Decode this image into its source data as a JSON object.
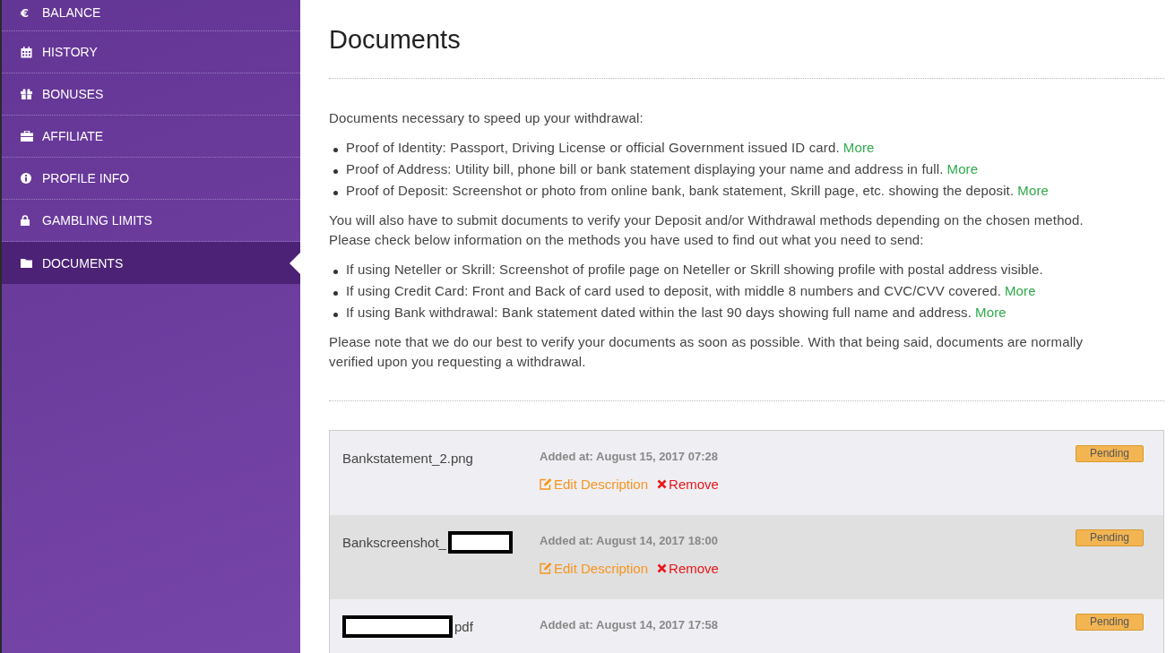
{
  "sidebar": {
    "items": [
      {
        "label": "BALANCE",
        "glyph": "€",
        "selected": false
      },
      {
        "label": "HISTORY",
        "selected": false
      },
      {
        "label": "BONUSES",
        "selected": false
      },
      {
        "label": "AFFILIATE",
        "selected": false
      },
      {
        "label": "PROFILE INFO",
        "selected": false
      },
      {
        "label": "GAMBLING LIMITS",
        "selected": false
      },
      {
        "label": "DOCUMENTS",
        "selected": true
      }
    ]
  },
  "page": {
    "title": "Documents",
    "sections": [
      {
        "kind": "paragraph",
        "text": "Documents necessary to speed up your withdrawal:"
      },
      {
        "kind": "list",
        "items": [
          {
            "text": "Proof of Identity: Passport, Driving License or official Government issued ID card.",
            "link": "More"
          },
          {
            "text": "Proof of Address: Utility bill, phone bill or bank statement displaying your name and address in full.",
            "link": "More"
          },
          {
            "text": "Proof of Deposit: Screenshot or photo from online bank, bank statement, Skrill page, etc. showing the deposit.",
            "link": "More"
          }
        ]
      },
      {
        "kind": "paragraph",
        "text": "You will also have to submit documents to verify your Deposit and/or Withdrawal methods depending on the chosen method. Please check below information on the methods you have used to find out what you need to send:"
      },
      {
        "kind": "list",
        "items": [
          {
            "text": "If using Neteller or Skrill: Screenshot of profile page on Neteller or Skrill showing profile with postal address visible."
          },
          {
            "text": "If using Credit Card: Front and Back of card used to deposit, with middle 8 numbers and CVC/CVV covered.",
            "link": "More"
          },
          {
            "text": "If using Bank withdrawal: Bank statement dated within the last 90 days showing full name and address.",
            "link": "More"
          }
        ]
      },
      {
        "kind": "paragraph",
        "text": "Please note that we do our best to verify your documents as soon as possible. With that being said, documents are normally verified upon you requesting a withdrawal."
      }
    ]
  },
  "documents": [
    {
      "name": "Bankstatement_2.png",
      "kind": "plain",
      "added": "Added at: August 15, 2017 07:28",
      "status": "Pending",
      "highlighted": false,
      "actions": [
        {
          "kind": "edit",
          "label": "Edit Description"
        },
        {
          "kind": "remove",
          "label": "Remove"
        }
      ]
    },
    {
      "name": "Bankscreenshot_",
      "kind": "redacted-end",
      "added": "Added at: August 14, 2017 18:00",
      "status": "Pending",
      "highlighted": true,
      "actions": [
        {
          "kind": "edit",
          "label": "Edit Description"
        },
        {
          "kind": "remove",
          "label": "Remove"
        }
      ]
    },
    {
      "name": "pdf",
      "kind": "redacted-start",
      "added": "Added at: August 14, 2017 17:58",
      "status": "Pending",
      "highlighted": false
    }
  ]
}
